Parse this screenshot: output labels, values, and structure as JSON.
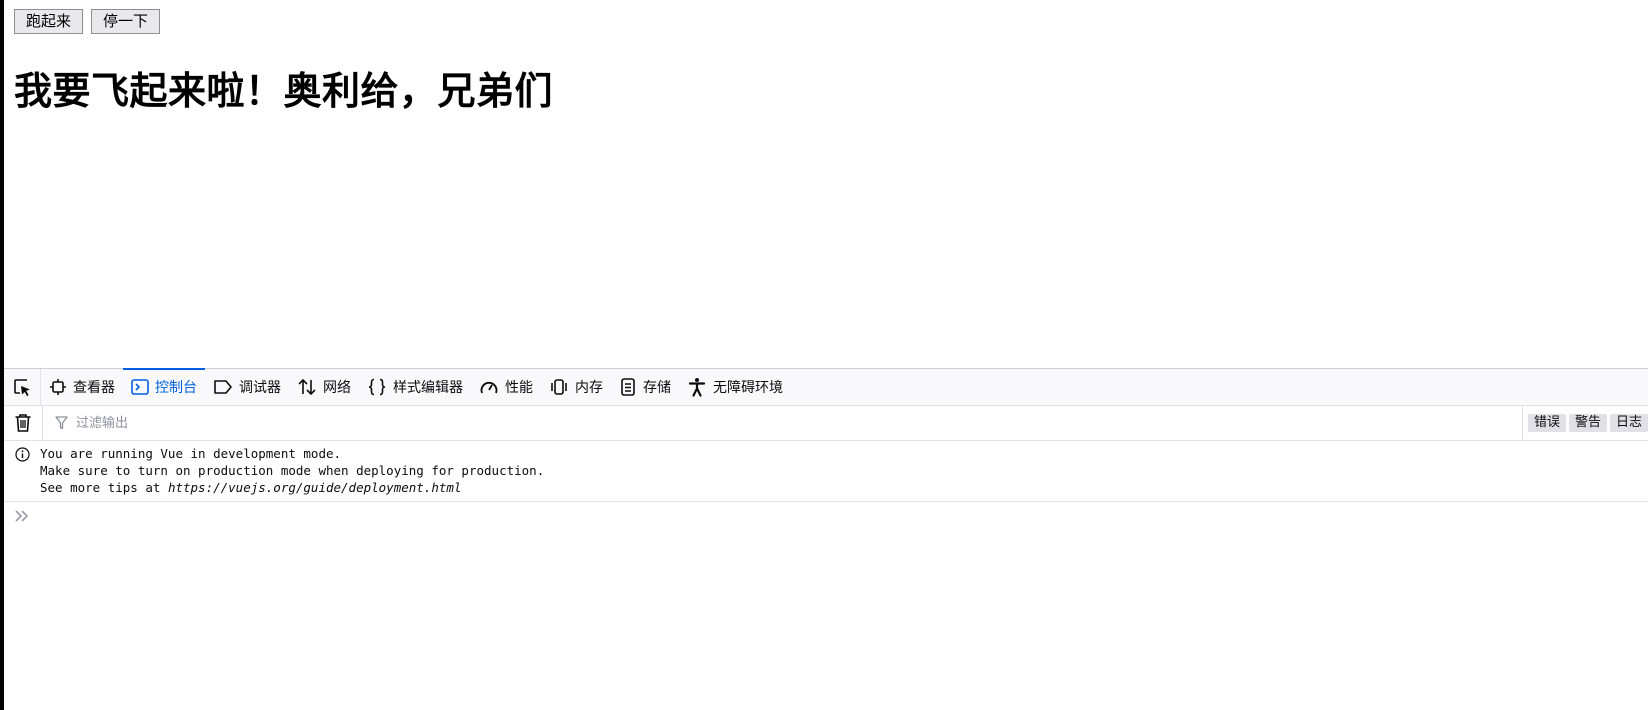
{
  "page": {
    "buttons": [
      "跑起来",
      "停一下"
    ],
    "heading": "我要飞起来啦！奥利给，兄弟们"
  },
  "devtools": {
    "tabs": [
      {
        "label": "查看器",
        "icon": "inspector-icon"
      },
      {
        "label": "控制台",
        "icon": "console-icon",
        "active": true
      },
      {
        "label": "调试器",
        "icon": "debugger-icon"
      },
      {
        "label": "网络",
        "icon": "network-icon"
      },
      {
        "label": "样式编辑器",
        "icon": "style-editor-icon"
      },
      {
        "label": "性能",
        "icon": "performance-icon"
      },
      {
        "label": "内存",
        "icon": "memory-icon"
      },
      {
        "label": "存储",
        "icon": "storage-icon"
      },
      {
        "label": "无障碍环境",
        "icon": "accessibility-icon"
      }
    ],
    "filter_placeholder": "过滤输出",
    "levels": [
      "错误",
      "警告",
      "日志"
    ],
    "message": {
      "line1": "You are running Vue in development mode.",
      "line2": "Make sure to turn on production mode when deploying for production.",
      "line3_prefix": "See more tips at ",
      "line3_url": "https://vuejs.org/guide/deployment.html"
    }
  },
  "colors": {
    "accent": "#0060df",
    "text": "#0c0c0d",
    "muted": "#8f8f9d"
  }
}
